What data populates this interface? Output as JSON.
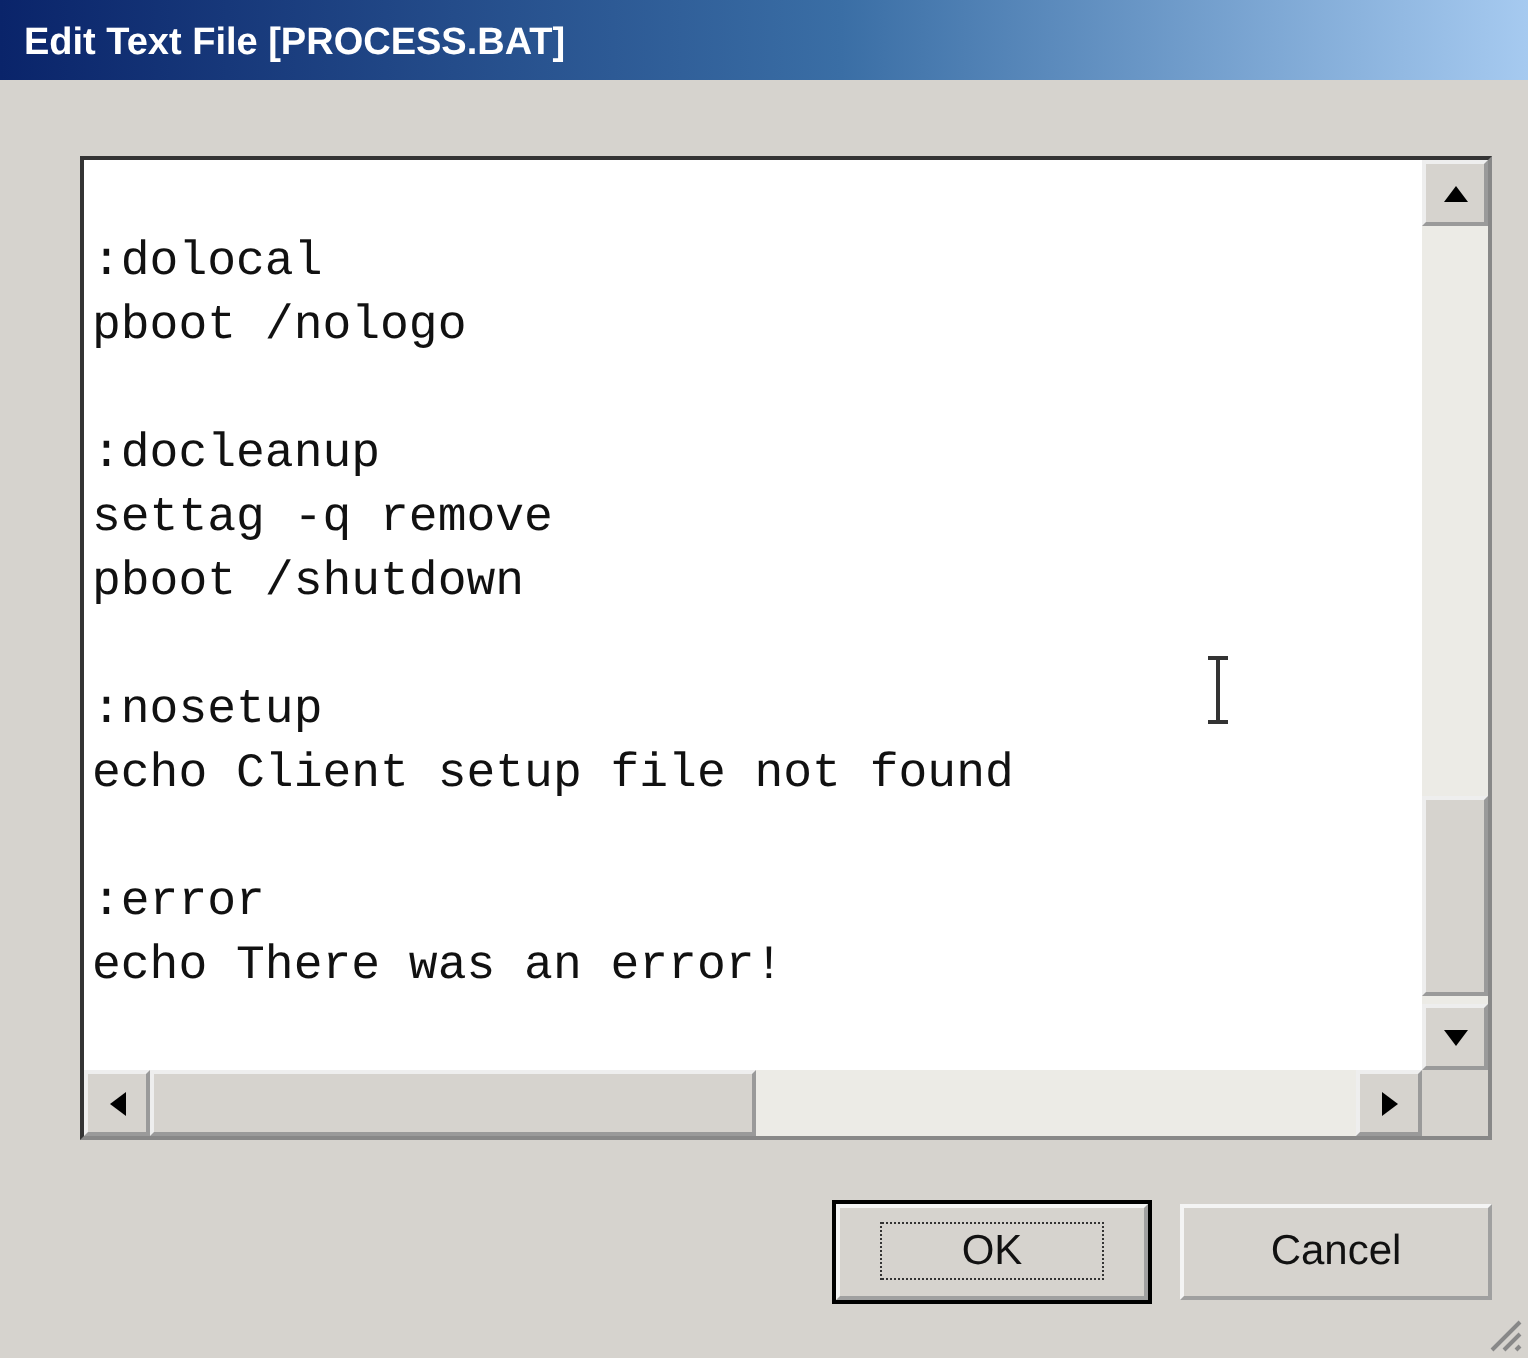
{
  "window": {
    "title": "Edit Text File [PROCESS.BAT]"
  },
  "editor": {
    "blocks": [
      [
        ":dolocal",
        "pboot /nologo"
      ],
      [
        ":docleanup",
        "settag -q remove",
        "pboot /shutdown"
      ],
      [
        ":nosetup",
        "echo Client setup file not found"
      ],
      [
        ":error",
        "echo There was an error!"
      ]
    ]
  },
  "buttons": [
    {
      "label": "OK",
      "default": true
    },
    {
      "label": "Cancel",
      "default": false
    }
  ]
}
